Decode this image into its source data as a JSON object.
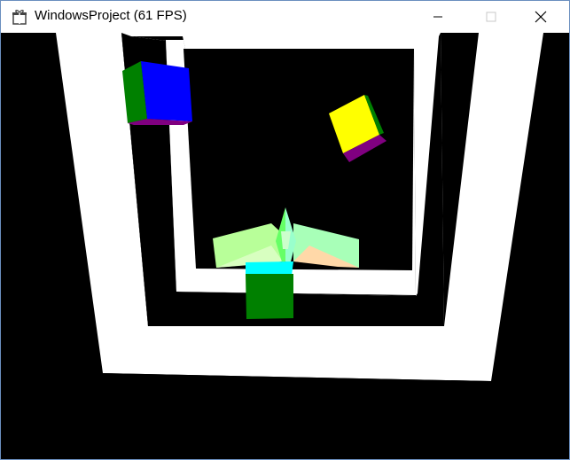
{
  "window": {
    "title": "WindowsProject (61 FPS)"
  },
  "titlebar": {
    "icons": {
      "app": "app-gift-icon",
      "minimize": "minimize-icon",
      "maximize": "maximize-icon",
      "close": "close-icon"
    },
    "maximize_enabled": false
  },
  "scene": {
    "background_color": "#000000",
    "tunnel_frame_color": "#ffffff",
    "cubes": [
      {
        "name": "blue-green-cube",
        "faces": [
          "#0000ff",
          "#008000",
          "#800080"
        ]
      },
      {
        "name": "yellow-cube",
        "faces": [
          "#ffff00",
          "#800080",
          "#008000"
        ]
      },
      {
        "name": "green-cyan-cube",
        "faces": [
          "#008000",
          "#00ffff"
        ]
      }
    ],
    "ship": {
      "name": "player-ship",
      "colors": [
        "#ccff99",
        "#99ff66",
        "#99ffcc",
        "#ffcc99"
      ]
    }
  }
}
